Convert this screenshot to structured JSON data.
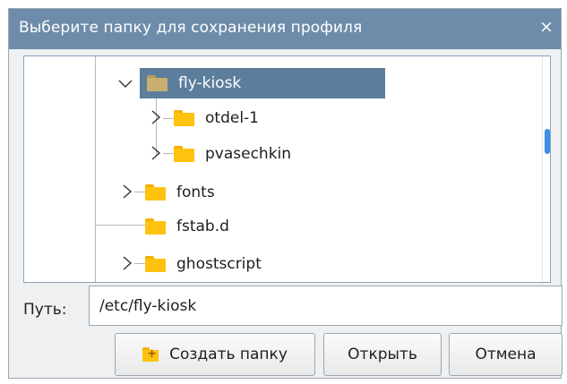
{
  "window": {
    "title": "Выберите папку для сохранения профиля",
    "close_glyph": "×"
  },
  "tree": {
    "items": [
      {
        "label": "fly-kiosk",
        "expanded": true,
        "selected": true,
        "level": 1
      },
      {
        "label": "otdel-1",
        "expanded": false,
        "selected": false,
        "level": 2
      },
      {
        "label": "pvasechkin",
        "expanded": false,
        "selected": false,
        "level": 2
      },
      {
        "label": "fonts",
        "expanded": false,
        "selected": false,
        "level": 1
      },
      {
        "label": "fstab.d",
        "expanded": null,
        "selected": false,
        "level": 1
      },
      {
        "label": "ghostscript",
        "expanded": false,
        "selected": false,
        "level": 1
      }
    ]
  },
  "path": {
    "label": "Путь:",
    "value": "/etc/fly-kiosk"
  },
  "buttons": {
    "create_folder": "Создать папку",
    "open": "Открыть",
    "cancel": "Отмена"
  },
  "icons": {
    "folder": "folder-icon",
    "new_folder": "new-folder-icon",
    "expand": "chevron-right-icon",
    "collapse": "chevron-down-icon",
    "close": "close-icon"
  },
  "colors": {
    "titlebar": "#6e8caa",
    "selection": "#5d7d9c",
    "folder": "#ffc30f",
    "scroll_thumb": "#3d8ee4"
  }
}
